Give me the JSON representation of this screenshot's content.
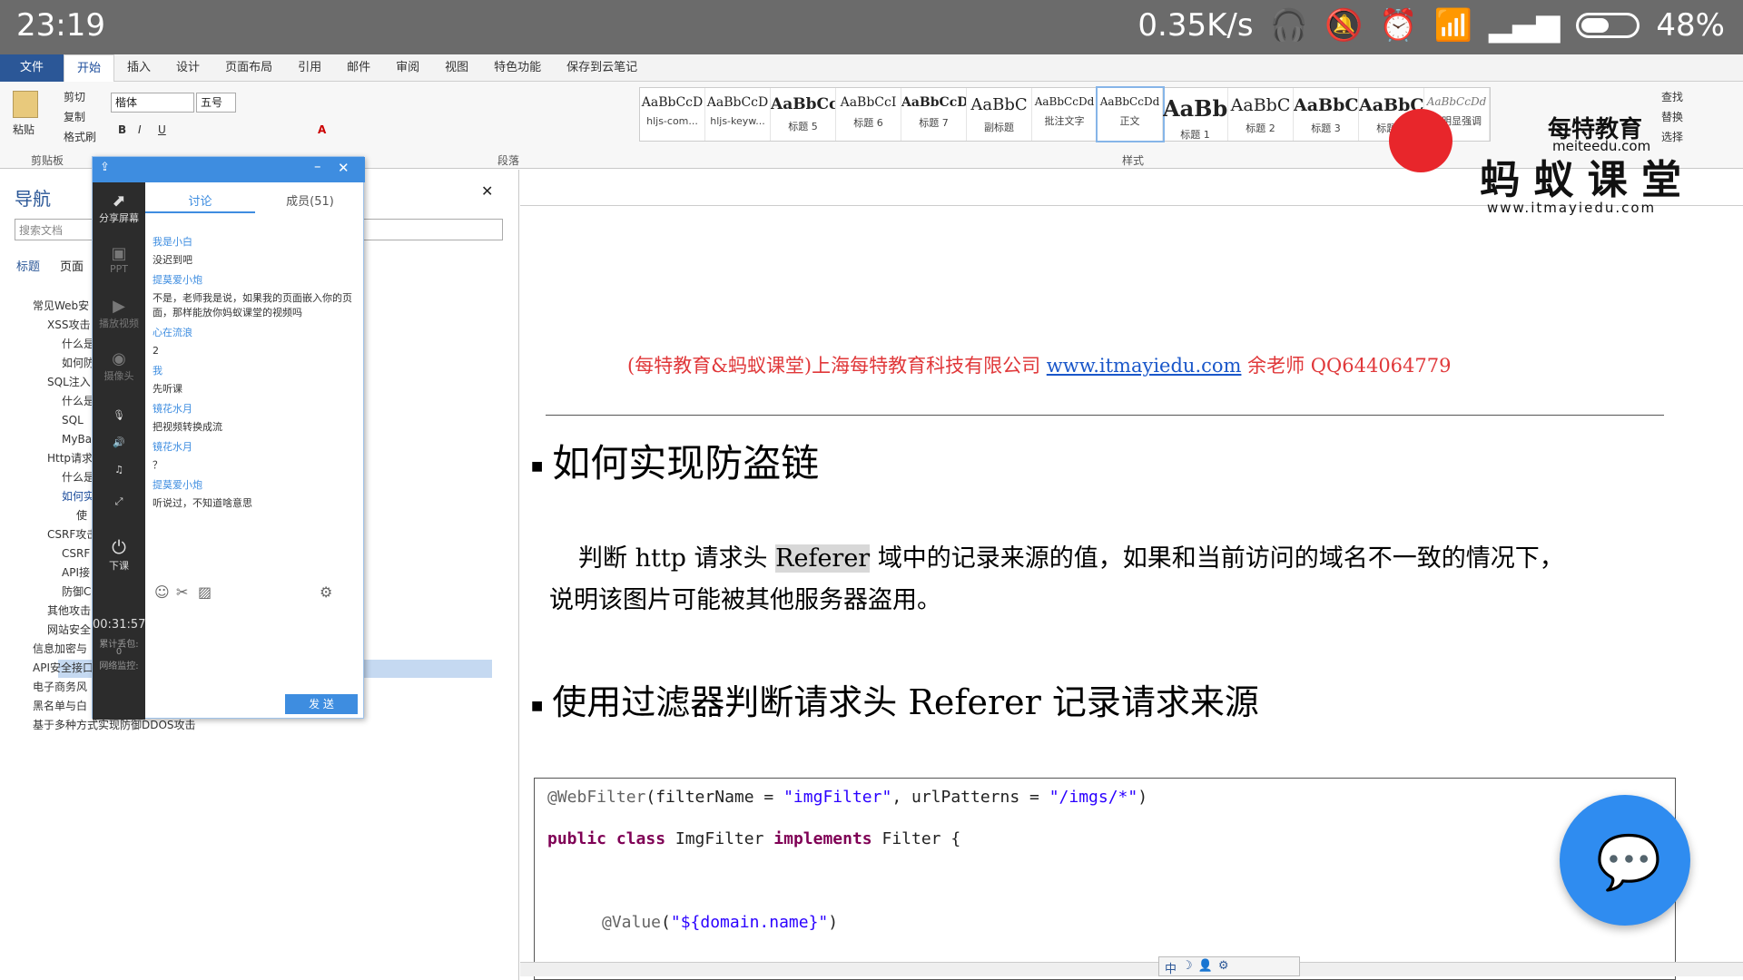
{
  "status": {
    "time": "23:19",
    "net_speed": "0.35K/s",
    "battery": "48%"
  },
  "ribbon": {
    "tabs": [
      "文件",
      "开始",
      "插入",
      "设计",
      "页面布局",
      "引用",
      "邮件",
      "审阅",
      "视图",
      "特色功能",
      "保存到云笔记"
    ],
    "clipboard": {
      "paste": "粘贴",
      "cut": "剪切",
      "copy": "复制",
      "format_painter": "格式刷",
      "group": "剪贴板"
    },
    "font": {
      "name": "楷体",
      "size": "五号"
    },
    "paragraph_group": "段落",
    "styles_group": "样式",
    "styles": [
      {
        "preview": "AaBbCcD",
        "name": "hljs-com..."
      },
      {
        "preview": "AaBbCcD",
        "name": "hljs-keyw..."
      },
      {
        "preview": "AaBbCc",
        "name": "标题 5"
      },
      {
        "preview": "AaBbCcI",
        "name": "标题 6"
      },
      {
        "preview": "AaBbCcD",
        "name": "标题 7"
      },
      {
        "preview": "AaBbC",
        "name": "副标题"
      },
      {
        "preview": "AaBbCcDd",
        "name": "批注文字"
      },
      {
        "preview": "AaBbCcDd",
        "name": "正文"
      },
      {
        "preview": "AaBb",
        "name": "标题 1"
      },
      {
        "preview": "AaBbC",
        "name": "标题 2"
      },
      {
        "preview": "AaBbC",
        "name": "标题 3"
      },
      {
        "preview": "AaBbC",
        "name": "标题 4"
      },
      {
        "preview": "AaBbCcDd",
        "name": "不明显强调"
      }
    ],
    "editing": {
      "find": "查找",
      "replace": "替换",
      "select": "选择"
    }
  },
  "nav": {
    "title": "导航",
    "search_placeholder": "搜索文档",
    "tabs": [
      "标题",
      "页面"
    ],
    "tree": [
      "常见Web安",
      "XSS攻击",
      "什么是",
      "如何防",
      "SQL注入",
      "什么是",
      "SQL",
      "MyBa",
      "Http请求",
      "什么是",
      "如何实",
      "使",
      "CSRF攻击",
      "CSRF",
      "API接",
      "防御C",
      "其他攻击",
      "网站安全",
      "信息加密与",
      "API安全接口",
      "电子商务风",
      "黑名单与白",
      "基于多种方式实现防御DDOS攻击"
    ]
  },
  "chat": {
    "side": [
      "分享屏幕",
      "PPT",
      "播放视频",
      "摄像头",
      "下课"
    ],
    "timer": "00:31:57",
    "stats": [
      "累计丢包:",
      "0",
      "网络监控:"
    ],
    "tabs": [
      "讨论",
      "成员(51)"
    ],
    "messages": [
      {
        "name": "我是小白",
        "text": "没迟到吧"
      },
      {
        "name": "提莫爱小炮",
        "text": "不是，老师我是说，如果我的页面嵌入你的页面，那样能放你妈蚁课堂的视频吗"
      },
      {
        "name": "心在流浪",
        "text": "2"
      },
      {
        "name": "我",
        "text": "先听课"
      },
      {
        "name": "镜花水月",
        "text": "把视频转换成流"
      },
      {
        "name": "镜花水月",
        "text": "？"
      },
      {
        "name": "提莫爱小炮",
        "text": "听说过，不知道啥意思"
      }
    ],
    "send": "发 送"
  },
  "doc": {
    "header_prefix": "(每特教育&蚂蚁课堂)上海每特教育科技有限公司",
    "header_link": "www.itmayiedu.com",
    "header_suffix": "余老师 QQ644064779",
    "h1_a": "如何实现防盗链",
    "para1_a": "判断 http 请求头",
    "para1_hl": "Referer",
    "para1_b": "域中的记录来源的值，如果和当前访问的域名不一致的情况下，",
    "para2": "说明该图片可能被其他服务器盗用。",
    "h1_b": "使用过滤器判断请求头 Referer 记录请求来源",
    "code": {
      "l1_ann": "@WebFilter",
      "l1_a": "(filterName = ",
      "l1_s1": "\"imgFilter\"",
      "l1_b": ", urlPatterns = ",
      "l1_s2": "\"/imgs/*\"",
      "l1_c": ")",
      "l2_k1": "public class",
      "l2_a": " ImgFilter ",
      "l2_k2": "implements",
      "l2_b": " Filter {",
      "l4_ann": "@Value",
      "l4_a": "(",
      "l4_s": "\"${domain.name}\"",
      "l4_b": ")"
    }
  },
  "logo": {
    "line1": "每特教育",
    "line2": "meiteedu.com",
    "line3": "蚂 蚁 课 堂",
    "line4": "www.itmayiedu.com"
  },
  "ime": [
    "中"
  ]
}
